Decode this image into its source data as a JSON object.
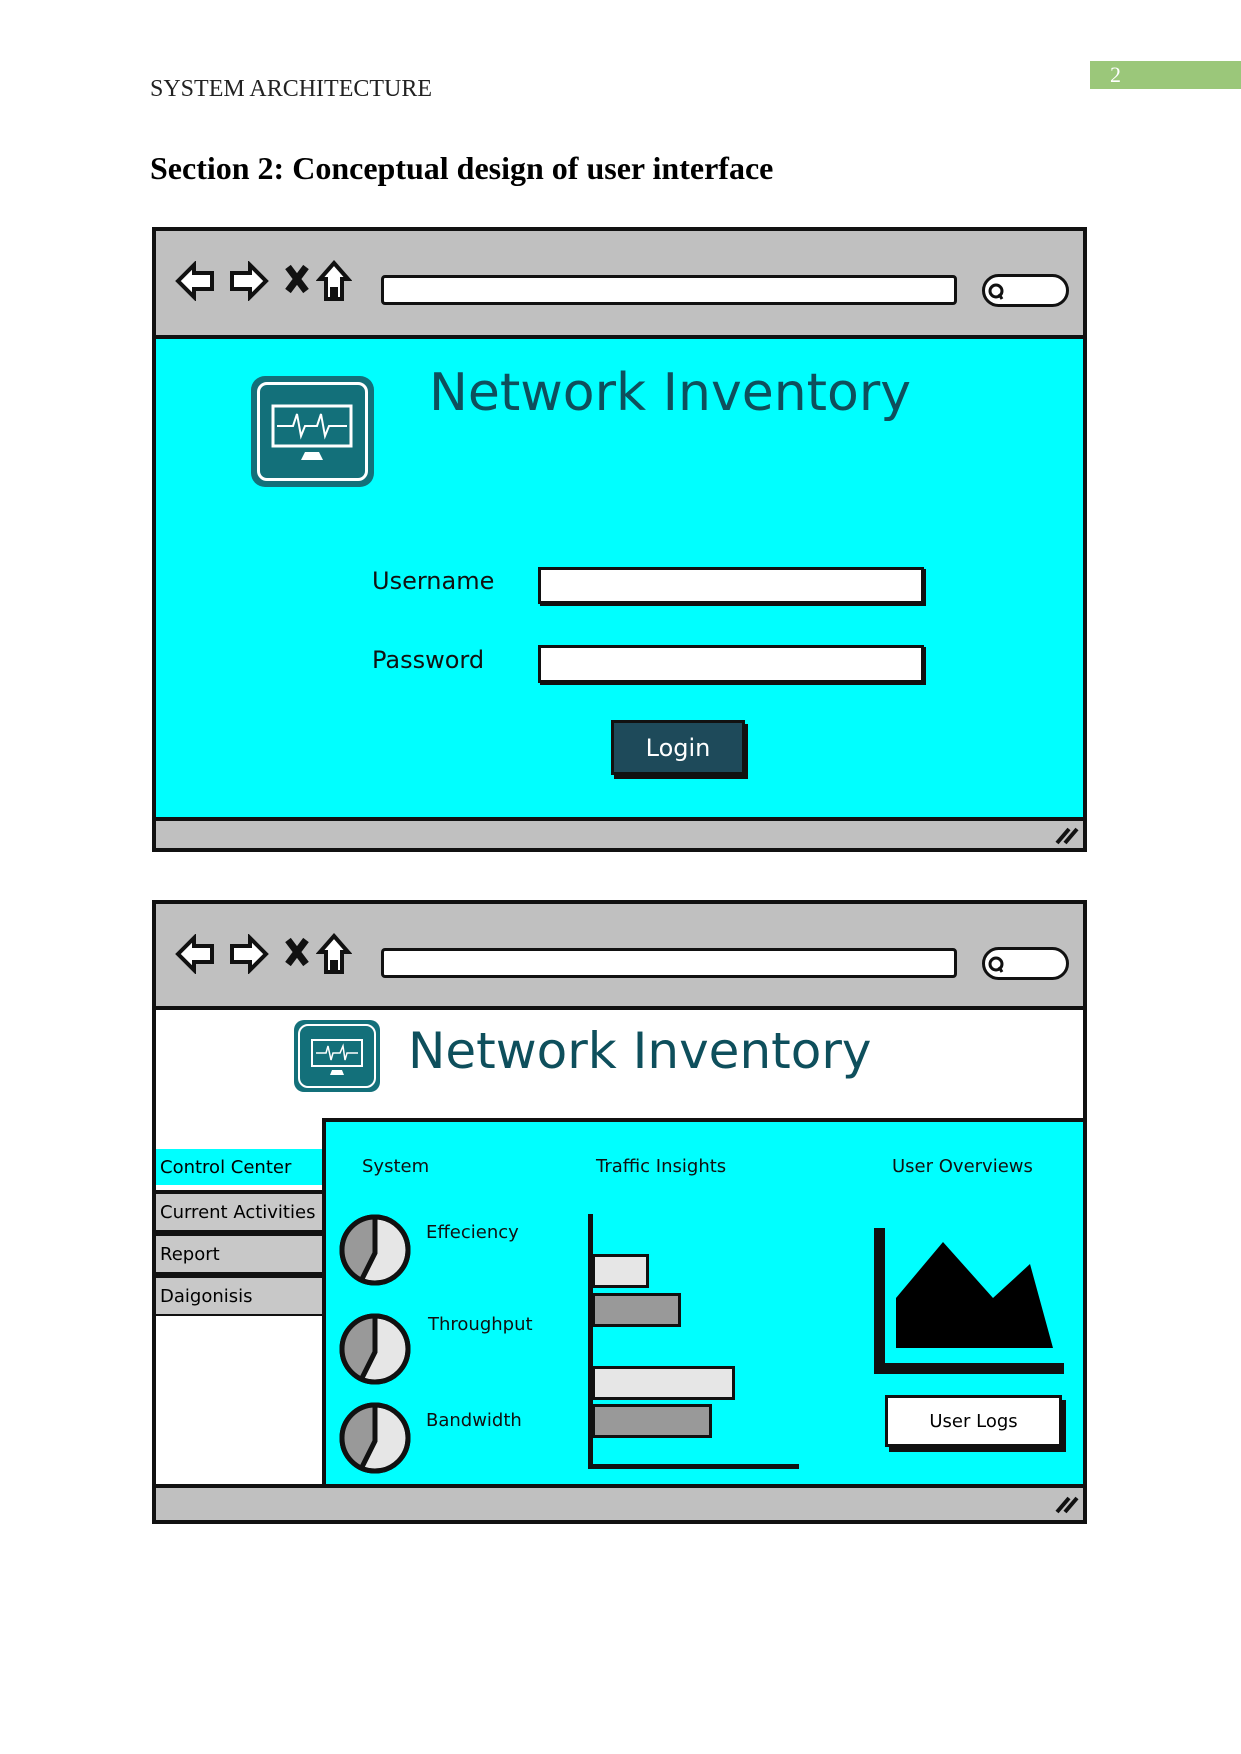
{
  "document": {
    "header": "SYSTEM ARCHITECTURE",
    "page_number": "2",
    "section_title": "Section 2: Conceptual design of user interface"
  },
  "colors": {
    "cyan": "#00ffff",
    "teal_logo": "#13707a",
    "title_text": "#0e4f5c",
    "login_button": "#1e4a5a",
    "chrome_gray": "#c0c0c0",
    "page_tab": "#9bc77a"
  },
  "browser": {
    "icons": [
      "back-arrow-icon",
      "forward-arrow-icon",
      "close-x-icon",
      "home-icon",
      "search-icon",
      "resize-grip-icon"
    ]
  },
  "login_screen": {
    "app_title": "Network Inventory",
    "logo_icon": "monitor-heartbeat-icon",
    "username_label": "Username",
    "username_value": "",
    "password_label": "Password",
    "password_value": "",
    "login_button": "Login"
  },
  "dashboard": {
    "app_title": "Network Inventory",
    "sidebar": [
      {
        "label": "Control Center",
        "active": true
      },
      {
        "label": "Current Activities",
        "active": false
      },
      {
        "label": "Report",
        "active": false
      },
      {
        "label": "Daigonisis",
        "active": false
      }
    ],
    "system": {
      "heading": "System",
      "metrics": [
        "Effeciency",
        "Throughput",
        "Bandwidth"
      ]
    },
    "traffic": {
      "heading": "Traffic Insights",
      "bars": [
        {
          "shade": "light",
          "level": 0.27
        },
        {
          "shade": "dark",
          "level": 0.42
        },
        {
          "shade": "light",
          "level": 0.68
        },
        {
          "shade": "dark",
          "level": 0.57
        }
      ]
    },
    "users": {
      "heading": "User Overviews",
      "button": "User Logs"
    }
  }
}
